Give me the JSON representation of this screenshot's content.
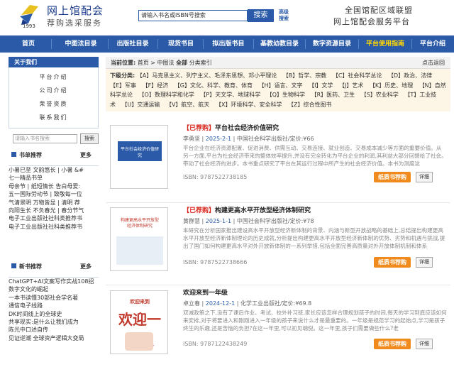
{
  "header": {
    "site_name": "网上馆配会",
    "slogan": "荐购选采服务",
    "year": "1993",
    "search_placeholder": "请输入书名或ISBN号搜索",
    "search_button": "搜索",
    "advanced_search": "高级搜索",
    "right_line1": "全国馆配区域联盟",
    "right_line2": "网上馆配会服务平台"
  },
  "nav": [
    {
      "label": "首页"
    },
    {
      "label": "中图法目录"
    },
    {
      "label": "出版社目录"
    },
    {
      "label": "现货书目"
    },
    {
      "label": "拟出版书目"
    },
    {
      "label": "基教幼教目录"
    },
    {
      "label": "数字资源目录"
    },
    {
      "label": "平台使用指南"
    },
    {
      "label": "平台介绍"
    }
  ],
  "sidebar": {
    "about_title": "关于我们",
    "about_items": [
      "平台介绍",
      "公司介绍",
      "荣誉资质",
      "联系我们"
    ],
    "search_placeholder": "请输入书名搜索",
    "search_button": "搜索",
    "rec_title": "书单推荐",
    "rec_more": "更多",
    "rec_items": [
      "小暑已至 文韵悠长 | 小暑 &#",
      "七一精品书单",
      "母亲节 | 纸短情长 告白母爱:",
      "五一国际劳动节 | 致敬每一位",
      "气清景明 万物皆显 | 清明 荐",
      "向阳生长 不负春光 | 春分节气",
      "电子工业出版社社科类推荐书",
      "电子工业出版社社科类推荐书"
    ],
    "new_title": "新书推荐",
    "new_more": "更多",
    "new_items": [
      "ChatGPT+AI文案写作实战108招",
      "数字文化的崛起",
      "一本书读懂30部社会学名著",
      "通信电子线路",
      "DK时间线上的全球史",
      "共享现实:是什么让我们成为",
      "陈光中口述自传",
      "见证逆潮 全球资产逻辑大变局"
    ]
  },
  "breadcrumb": {
    "current_label": "当前位置:",
    "home": "首页",
    "sep1": " > ",
    "cat": "中图法",
    "all": "全部",
    "index": "分类索引",
    "back_home": "点击返回"
  },
  "categories": {
    "label": "下级分类:",
    "items": [
      "【A】马克思主义、列宁主义、毛泽东思想、邓小平理论",
      "【B】哲学、宗教",
      "【C】社会科学总论",
      "【D】政治、法律",
      "【E】军事",
      "【F】经济",
      "【G】文化、科学、教育、体育",
      "【H】语言、文字",
      "【I】文学",
      "【J】艺术",
      "【K】历史、地理",
      "【N】自然科学总论",
      "【O】数理科学和化学",
      "【P】天文学、地球科学",
      "【Q】生物科学",
      "【R】医药、卫生",
      "【S】农业科学",
      "【T】工业技术",
      "【U】交通运输",
      "【V】航空、航天",
      "【X】环境科学、安全科学",
      "【Z】综合性图书"
    ]
  },
  "books": [
    {
      "tag": "【已荐购】",
      "title": "平台社会经济价值研究",
      "author": "李勇坚",
      "date": "2025-2-1",
      "publisher": "中国社会科学出版社",
      "price": "/定价:¥66",
      "desc": "平台企业在经济资源配置、促进消费、供需互动、交易连接、就业创造、交易成本减少等方面的重要价值。从另一方面,平台为社会经济带来的整体效率提升,并没有完全转化为平台企业的利润,其利益大部分回馈给了社会。带动了社会经济的进步。本书重点研究了平台在其运行过程中所产生的社会经济价值。本书为测度这",
      "isbn": "ISBN: 9787522738185",
      "rec_button": "纸质书荐购",
      "detail_button": "详细",
      "cover_title": "平台社会经济价值研究"
    },
    {
      "tag": "【已荐购】",
      "title": "构建更高水平开放型经济体制研究",
      "author": "黄群慧",
      "date": "2025-1-1",
      "publisher": "中国社会科学出版社",
      "price": "/定价:¥78",
      "desc": "本研究在分析国家推出建设高水平开放型经济新体制的背景、内涵与新型开放战略的基础上,总结提出构建更高水平开放型经济新体制理论的历史成就,分析提出构建更高水平开放型经济新体制的优势、劣势和机遇与挑战,提出了国门如何构建更高水平对外开放新体制的一系列举措,包括全面完善高质量对外开放体制机制和体系",
      "isbn": "ISBN: 9787522738666",
      "rec_button": "纸质书荐购",
      "detail_button": "详细",
      "cover_title": "构建更高水平开放型经济体制研究"
    },
    {
      "tag": "",
      "title": "欢迎来到一年级",
      "author": "卓立春",
      "date": "2024-12-1",
      "publisher": "化学工业出版社",
      "price": "/定价:¥69.8",
      "desc": "双减政策之下,没有了课后作业、考试、校外补习班,家长应该怎样合理规划孩子的时间,每天的学习到底应该如何来安排,对于将要进入和刚刚进入一年级的孩子来说什么才是最重要的。一年级是规范学习的起始点,学习是孩子终生的乐趣,还是苦恼的负担?在这一年里,可以初见端倪。这一年里,孩子们需要做些什么?老",
      "isbn": "ISBN: 9787122438249",
      "rec_button": "纸质书荐购",
      "detail_button": "详细",
      "cover_title": "欢迎一年级"
    }
  ],
  "colors": {
    "primary": "#2a5aa8",
    "accent_orange": "#f08a1c",
    "tag_red": "#d8281e",
    "nav_active": "#ffd700"
  }
}
